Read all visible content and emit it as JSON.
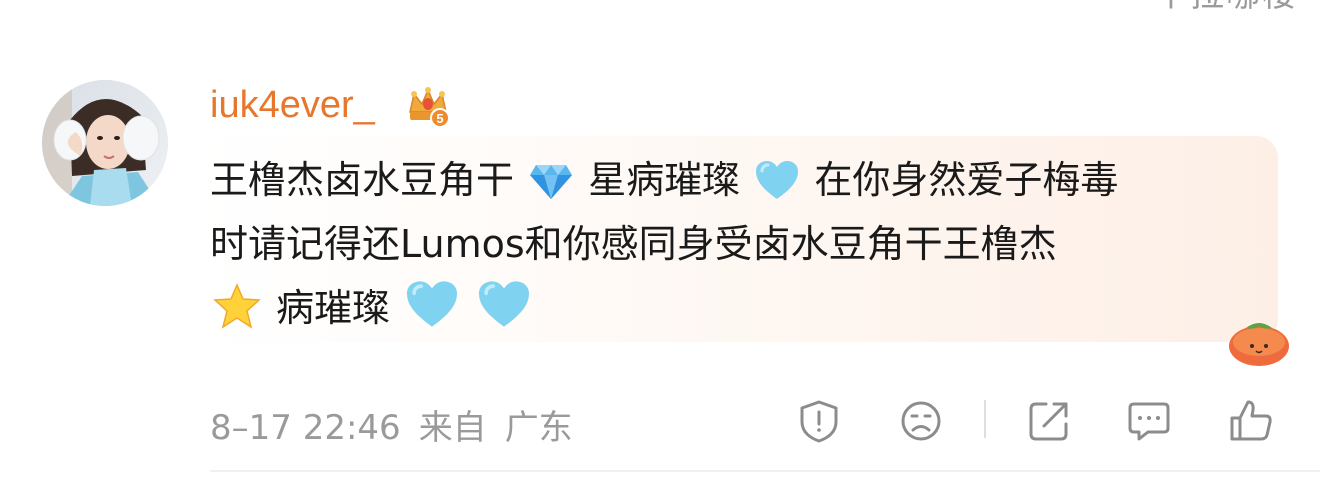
{
  "header": {
    "partial_top_text": "一个拉哪楼"
  },
  "comment": {
    "username": "iuk4ever_",
    "badge_level": "5",
    "lines": [
      [
        "王橹杰卤水豆角干",
        "💎",
        "星病璀璨",
        "🩵",
        "在你身然爱子梅毒"
      ],
      [
        "时请记得还Lumos和你感同身受卤水豆角干王橹杰"
      ],
      [
        "⭐",
        "病璀璨",
        "🩵",
        "🩵"
      ]
    ],
    "date": "8–17 22:46",
    "from_label": "来自",
    "location": "广东"
  },
  "icons": {
    "crown": "crown-badge-icon",
    "persimmon": "persimmon-sticker-icon",
    "report": "report-icon",
    "dislike": "sad-face-icon",
    "share": "share-icon",
    "reply": "comment-icon",
    "like": "thumbs-up-icon"
  },
  "colors": {
    "username": "#e8772e",
    "meta": "#9a9a9a",
    "icon_stroke": "#8c8c8c",
    "bubble_end": "#fdefe6"
  }
}
